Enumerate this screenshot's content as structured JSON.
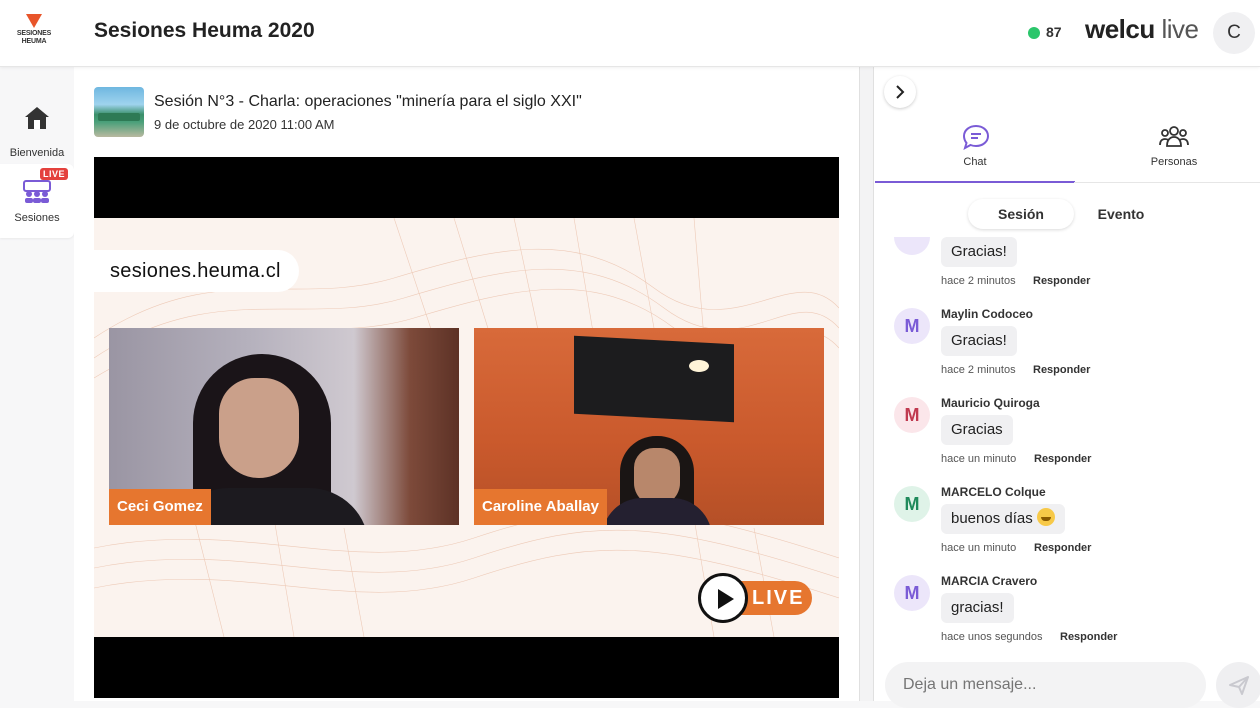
{
  "header": {
    "app_title": "Sesiones Heuma 2020",
    "logo_text": "SESIONES HEUMA",
    "viewer_count": "87",
    "brand_bold": "welcu",
    "brand_light": "live",
    "user_initial": "C",
    "status_color": "#2bc66b"
  },
  "nav": {
    "items": [
      {
        "label": "Bienvenida",
        "icon": "home-icon"
      },
      {
        "label": "Sesiones",
        "icon": "people-group-icon",
        "badge": "LIVE"
      }
    ]
  },
  "session": {
    "title": "Sesión N°3 - Charla: operaciones \"minería para el siglo XXI\"",
    "date": "9 de octubre de 2020 11:00 AM"
  },
  "video": {
    "url_overlay": "sesiones.heuma.cl",
    "participants": [
      {
        "name": "Ceci Gomez"
      },
      {
        "name": "Caroline Aballay"
      }
    ],
    "live_label": "LIVE",
    "accent": "#e6762f"
  },
  "panel": {
    "tabs": [
      {
        "label": "Chat",
        "icon": "chat-icon"
      },
      {
        "label": "Personas",
        "icon": "people-icon"
      }
    ],
    "segments": [
      "Sesión",
      "Evento"
    ],
    "reply_label": "Responder",
    "messages": [
      {
        "author": "",
        "text": "Gracias!",
        "time": "hace 2 minutos",
        "initial": "",
        "color": "#7a5bd6"
      },
      {
        "author": "Maylin Codoceo",
        "text": "Gracias!",
        "time": "hace 2 minutos",
        "initial": "M",
        "color": "#7a5bd6"
      },
      {
        "author": "Mauricio Quiroga",
        "text": "Gracias",
        "time": "hace un minuto",
        "initial": "M",
        "color": "#c0394f"
      },
      {
        "author": "MARCELO Colque",
        "text": "buenos días",
        "time": "hace un minuto",
        "initial": "M",
        "color": "#1f8a5b"
      },
      {
        "author": "MARCIA Cravero",
        "text": "gracias!",
        "time": "hace unos segundos",
        "initial": "M",
        "color": "#7a5bd6"
      }
    ],
    "composer_placeholder": "Deja un mensaje..."
  }
}
